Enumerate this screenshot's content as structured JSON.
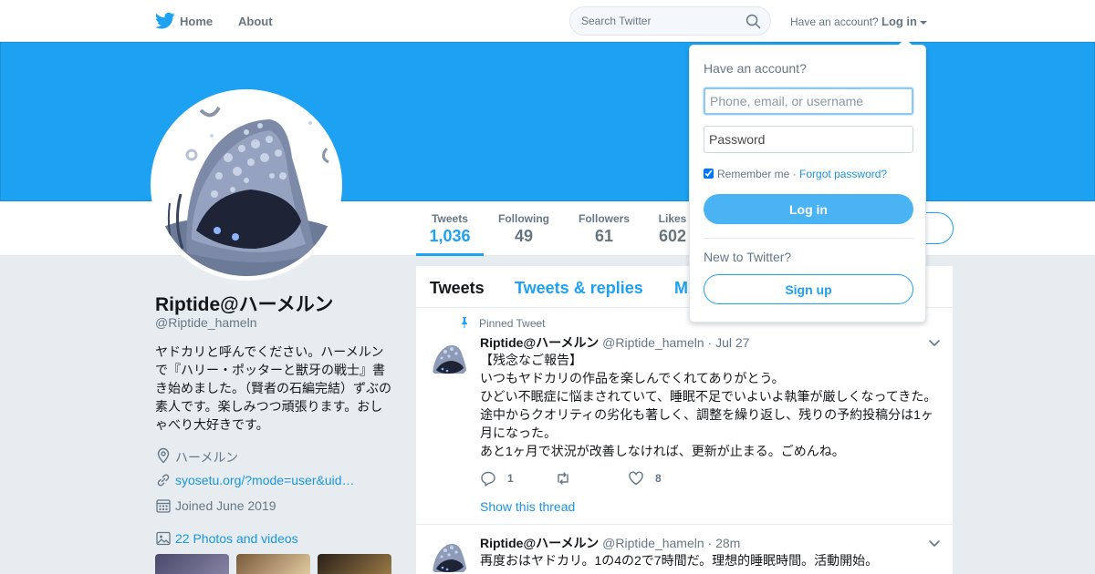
{
  "nav": {
    "home_label": "Home",
    "about_label": "About",
    "search_placeholder": "Search Twitter",
    "account_prompt": "Have an account?",
    "login_label": "Log in"
  },
  "profile": {
    "name": "Riptide@ハーメルン",
    "handle": "@Riptide_hameln",
    "bio": "ヤドカリと呼んでください。ハーメルンで『ハリー・ポッターと獣牙の戦士』書き始めました。（賢者の石編完結）ずぶの素人です。楽しみつつ頑張ります。おしゃべり大好きです。",
    "location": "ハーメルン",
    "url": "syosetu.org/?mode=user&uid…",
    "joined": "Joined June 2019",
    "photos": "22 Photos and videos"
  },
  "stats": [
    {
      "label": "Tweets",
      "value": "1,036"
    },
    {
      "label": "Following",
      "value": "49"
    },
    {
      "label": "Followers",
      "value": "61"
    },
    {
      "label": "Likes",
      "value": "602"
    }
  ],
  "timeline": {
    "tabs": [
      "Tweets",
      "Tweets & replies",
      "M"
    ],
    "tweets": [
      {
        "pinned_label": "Pinned Tweet",
        "name": "Riptide@ハーメルン",
        "handle": "@Riptide_hameln",
        "date": "· Jul 27",
        "lines": [
          "【残念なご報告】",
          "いつもヤドカリの作品を楽しんでくれてありがとう。",
          "ひどい不眠症に悩まされていて、睡眠不足でいよいよ執筆が厳しくなってきた。",
          "途中からクオリティの劣化も著しく、調整を繰り返し、残りの予約投稿分は1ヶ",
          "月になった。",
          "あと1ヶ月で状況が改善しなければ、更新が止まる。ごめんね。"
        ],
        "reply_count": "1",
        "retweet_count": "",
        "like_count": "8",
        "show_thread": "Show this thread"
      },
      {
        "name": "Riptide@ハーメルン",
        "handle": "@Riptide_hameln",
        "date": "· 28m",
        "lines": [
          "再度おはヤドカリ。1の4の2で7時間だ。理想的睡眠時間。活動開始。"
        ]
      }
    ]
  },
  "login_dropdown": {
    "title": "Have an account?",
    "username_placeholder": "Phone, email, or username",
    "password_placeholder": "Password",
    "remember_label": "Remember me",
    "separator": "·",
    "forgot_label": "Forgot password?",
    "login_button": "Log in",
    "new_label": "New to Twitter?",
    "signup_button": "Sign up"
  },
  "colors": {
    "brand_blue": "#1da1f2",
    "banner": "#1da1f2",
    "link": "#1b95e0",
    "page_bg": "#e6ecf0"
  }
}
